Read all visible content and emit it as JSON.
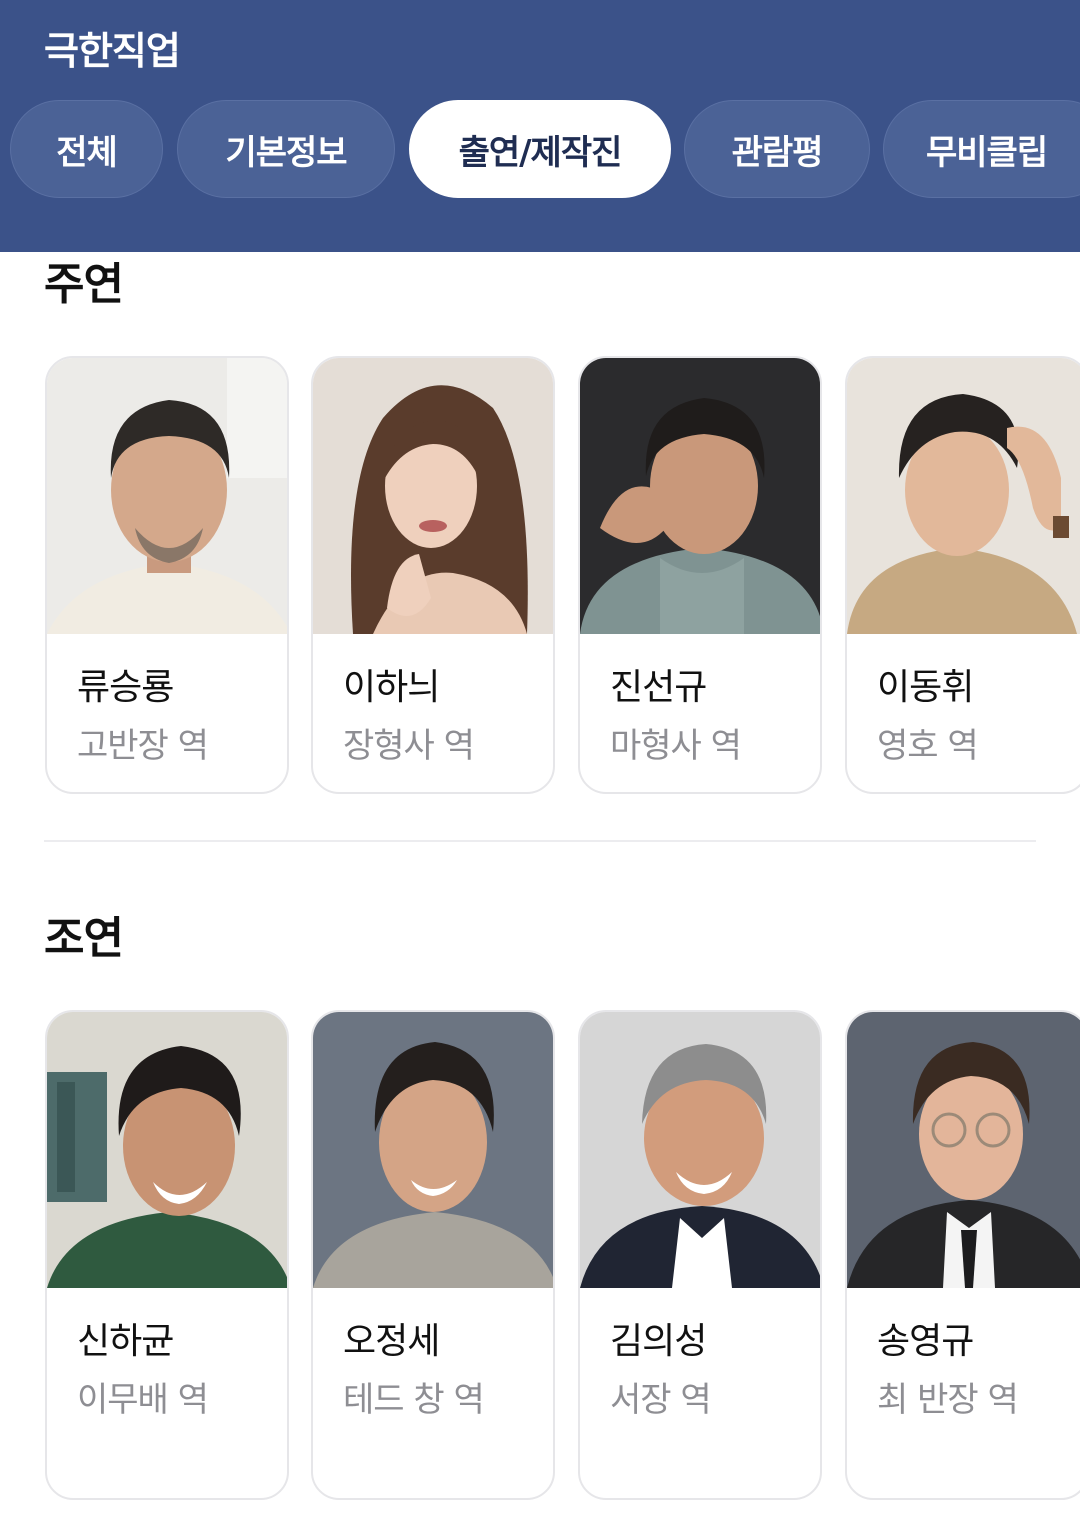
{
  "header": {
    "title": "극한직업",
    "tabs": [
      {
        "label": "전체",
        "active": false
      },
      {
        "label": "기본정보",
        "active": false
      },
      {
        "label": "출연/제작진",
        "active": true
      },
      {
        "label": "관람평",
        "active": false
      },
      {
        "label": "무비클립",
        "active": false
      }
    ]
  },
  "sections": {
    "lead": {
      "title": "주연",
      "cast": [
        {
          "name": "류승룡",
          "role": "고반장 역"
        },
        {
          "name": "이하늬",
          "role": "장형사 역"
        },
        {
          "name": "진선규",
          "role": "마형사 역"
        },
        {
          "name": "이동휘",
          "role": "영호 역"
        }
      ]
    },
    "supporting": {
      "title": "조연",
      "cast": [
        {
          "name": "신하균",
          "role": "이무배 역"
        },
        {
          "name": "오정세",
          "role": "테드 창 역"
        },
        {
          "name": "김의성",
          "role": "서장 역"
        },
        {
          "name": "송영규",
          "role": "최 반장 역"
        }
      ]
    }
  },
  "colors": {
    "header_bg": "#3b5289",
    "tab_bg": "#4b6296",
    "tab_active_bg": "#ffffff",
    "role_text": "#8e8e93"
  }
}
